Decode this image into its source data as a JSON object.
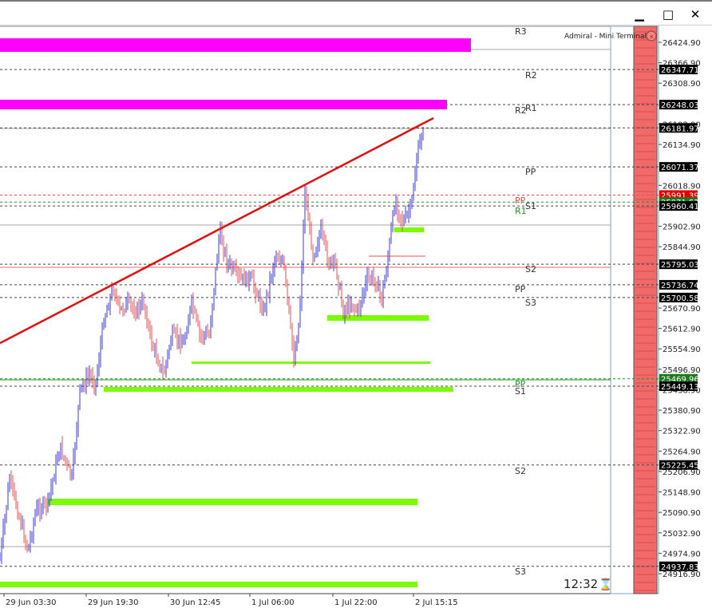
{
  "window": {
    "minimize_icon": "minimize-icon",
    "maximize_icon": "maximize-icon",
    "close_icon": "close-icon"
  },
  "terminal_label": "Admiral - Mini Terminal",
  "clock": "12:32",
  "colors": {
    "bull": "#3b3bdc",
    "bear": "#e05050",
    "trendline": "#e01010",
    "zone_magenta": "#ff00ff",
    "zone_green": "#7cfc00",
    "red_panel": "#f06a6a"
  },
  "pivot_labels": {
    "R3_top": "R3",
    "R2_a": "R2",
    "R2_b": "R2",
    "R1_a": "R1",
    "PP_a": "PP",
    "PP_red": "PP",
    "S1_a": "S1",
    "R1_green": "R1",
    "S2_a": "S2",
    "PP_b": "PP",
    "S3_a": "S3",
    "PP_green": "PP",
    "S1_b": "S1",
    "S2_b": "S2",
    "S3_b": "S3"
  },
  "axis": {
    "ticks": [
      "26424.90",
      "26366.90",
      "26308.90",
      "26192.90",
      "26134.90",
      "26018.90",
      "25902.90",
      "25844.90",
      "25670.90",
      "25612.90",
      "25554.90",
      "25496.90",
      "25438.90",
      "25380.90",
      "25322.90",
      "25264.90",
      "25206.90",
      "25148.90",
      "25090.90",
      "25032.90",
      "24974.90",
      "24916.90"
    ],
    "x_labels": [
      "29 Jun 03:30",
      "29 Jun 19:30",
      "30 Jun 12:45",
      "1 Jul 06:00",
      "1 Jul 22:00",
      "2 Jul 15:15"
    ]
  },
  "price_tags": [
    {
      "value": "26347.71",
      "style": "black"
    },
    {
      "value": "26248.03",
      "style": "black"
    },
    {
      "value": "26181.97",
      "style": "black"
    },
    {
      "value": "26071.37",
      "style": "black"
    },
    {
      "value": "25991.39",
      "style": "red"
    },
    {
      "value": "25971.57",
      "style": "green"
    },
    {
      "value": "25960.41",
      "style": "black"
    },
    {
      "value": "25795.03",
      "style": "black"
    },
    {
      "value": "25736.74",
      "style": "black"
    },
    {
      "value": "25700.58",
      "style": "black"
    },
    {
      "value": "25469.96",
      "style": "green"
    },
    {
      "value": "25449.13",
      "style": "black"
    },
    {
      "value": "25225.45",
      "style": "black"
    },
    {
      "value": "24937.83",
      "style": "black"
    }
  ]
}
